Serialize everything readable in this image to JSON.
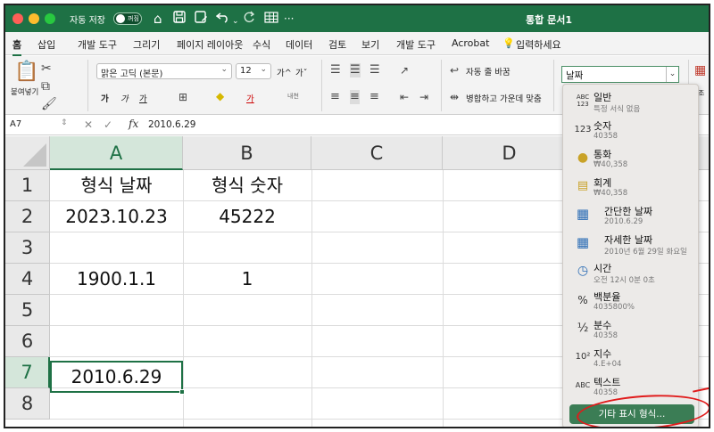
{
  "titlebar": {
    "autosave_label": "자동 저장",
    "autosave_state": "꺼짐",
    "doc_title": "통합 문서1",
    "more": "···"
  },
  "menu": {
    "tabs": [
      "홈",
      "삽입",
      "개발 도구",
      "그리기",
      "페이지 레이아웃",
      "수식",
      "데이터",
      "검토",
      "보기",
      "개발 도구",
      "Acrobat"
    ],
    "tell_me": "입력하세요"
  },
  "ribbon": {
    "paste": "붙여넣기",
    "font_name": "맑은 고딕 (본문)",
    "font_size": "12",
    "grow": "가^",
    "shrink": "가ˇ",
    "bold": "가",
    "italic": "가",
    "underline": "가",
    "wrap_text": "자동 줄 바꿈",
    "merge_center": "병합하고 가운데 맞춤",
    "number_format": "날짜",
    "ruby": "내천",
    "side_cut": "조"
  },
  "formula_bar": {
    "name_box": "A7",
    "fx": "fx",
    "formula": "2010.6.29"
  },
  "grid": {
    "columns": [
      "A",
      "B",
      "C",
      "D"
    ],
    "rows": [
      "1",
      "2",
      "3",
      "4",
      "5",
      "6",
      "7",
      "8"
    ],
    "cells": {
      "A1": "형식 날짜",
      "B1": "형식 숫자",
      "A2": "2023.10.23",
      "B2": "45222",
      "A4": "1900.1.1",
      "B4": "1",
      "A7": "2010.6.29"
    }
  },
  "format_panel": {
    "items": [
      {
        "icon": "ABC 123",
        "name": "일반",
        "sample": "특정 서식 없음"
      },
      {
        "icon": "123",
        "name": "숫자",
        "sample": "40358"
      },
      {
        "icon": "coins",
        "name": "통화",
        "sample": "₩40,358"
      },
      {
        "icon": "ledger",
        "name": "회계",
        "sample": "₩40,358"
      },
      {
        "icon": "calendar-clock",
        "name": "간단한 날짜",
        "sample": "2010.6.29"
      },
      {
        "icon": "calendar-clock",
        "name": "자세한 날짜",
        "sample": "2010년 6월 29일 화요일"
      },
      {
        "icon": "clock",
        "name": "시간",
        "sample": "오전 12시 0분 0초"
      },
      {
        "icon": "%",
        "name": "백분율",
        "sample": "4035800%"
      },
      {
        "icon": "½",
        "name": "분수",
        "sample": "40358"
      },
      {
        "icon": "10²",
        "name": "지수",
        "sample": "4.E+04"
      },
      {
        "icon": "ABC",
        "name": "텍스트",
        "sample": "40358"
      }
    ],
    "more_formats": "기타 표시 형식..."
  },
  "colors": {
    "excel_green": "#1e7145",
    "highlight_red": "#e01b1b"
  }
}
